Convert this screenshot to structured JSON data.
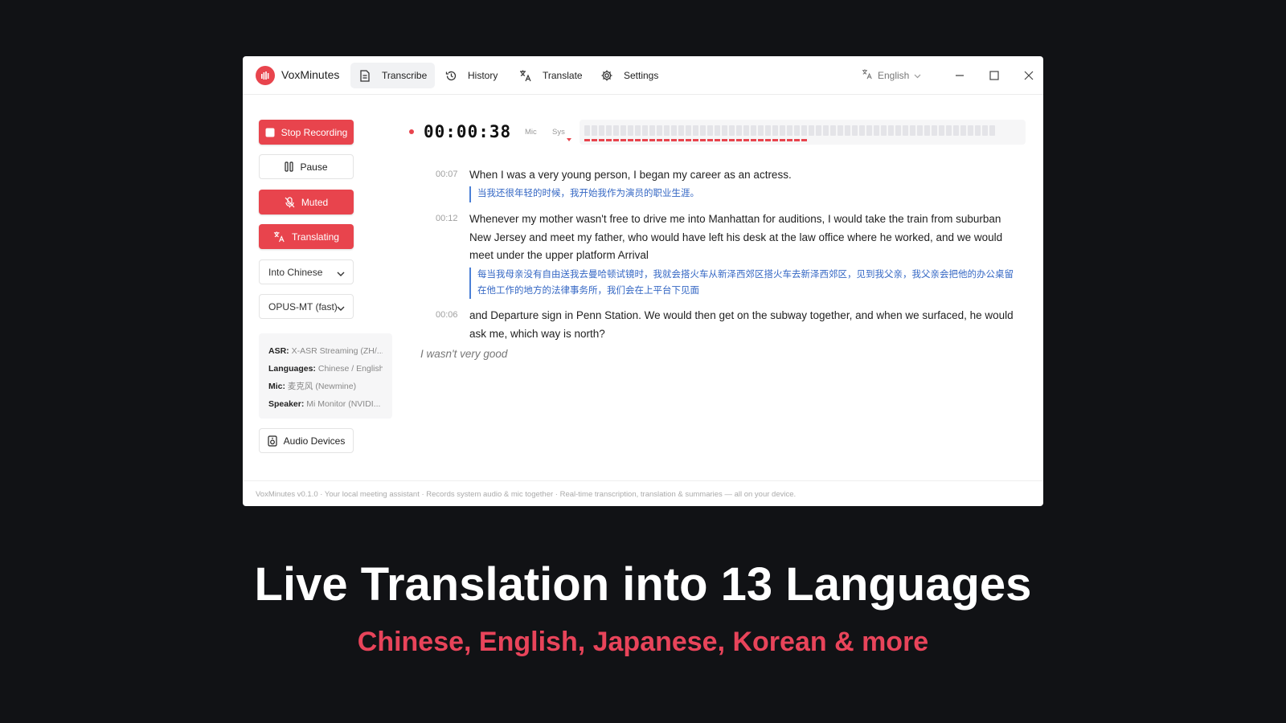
{
  "app": {
    "name": "VoxMinutes"
  },
  "nav": {
    "tabs": [
      {
        "label": "Transcribe",
        "icon": "document-icon",
        "active": true
      },
      {
        "label": "History",
        "icon": "history-icon"
      },
      {
        "label": "Translate",
        "icon": "translate-icon"
      },
      {
        "label": "Settings",
        "icon": "gear-icon"
      }
    ],
    "language": "English"
  },
  "controls": {
    "stop_label": "Stop Recording",
    "pause_label": "Pause",
    "muted_label": "Muted",
    "translating_label": "Translating",
    "target_language": "Into Chinese",
    "model": "OPUS-MT (fast)",
    "devices_label": "Audio Devices"
  },
  "info": {
    "asr_label": "ASR:",
    "asr_value": "X-ASR Streaming (ZH/...",
    "languages_label": "Languages:",
    "languages_value": "Chinese / English",
    "mic_label": "Mic:",
    "mic_value": "麦克风 (Newmine)",
    "speaker_label": "Speaker:",
    "speaker_value": "Mi Monitor (NVIDI..."
  },
  "recording": {
    "timer": "00:00:38",
    "mic_label": "Mic",
    "sys_label": "Sys",
    "bar_count": 57,
    "level_fraction": 0.54
  },
  "transcript": [
    {
      "time": "00:07",
      "text": "When I was a very young person, I began my career as an actress.",
      "translation": "当我还很年轻的时候，我开始我作为演员的职业生涯。"
    },
    {
      "time": "00:12",
      "text": "Whenever my mother wasn't free to drive me into Manhattan for auditions, I would take the train from suburban New Jersey and meet my father, who would have left his desk at the law office where he worked, and we would meet under the upper platform Arrival",
      "translation": "每当我母亲没有自由送我去曼哈顿试镜时，我就会搭火车从新泽西郊区搭火车去新泽西郊区，见到我父亲，我父亲会把他的办公桌留在他工作的地方的法律事务所，我们会在上平台下见面"
    },
    {
      "time": "00:06",
      "text": "and Departure sign in Penn Station. We would then get on the subway together, and when we surfaced, he would ask me, which way is north?"
    }
  ],
  "partial": "I wasn't very good",
  "footer": "VoxMinutes v0.1.0 · Your local meeting assistant · Records system audio & mic together · Real-time transcription, translation & summaries — all on your device.",
  "banner": {
    "headline": "Live Translation into 13 Languages",
    "subline": "Chinese, English, Japanese, Korean & more"
  },
  "colors": {
    "accent": "#e8444d",
    "translation": "#3467c4",
    "subline": "#e8445a",
    "background": "#111215"
  }
}
